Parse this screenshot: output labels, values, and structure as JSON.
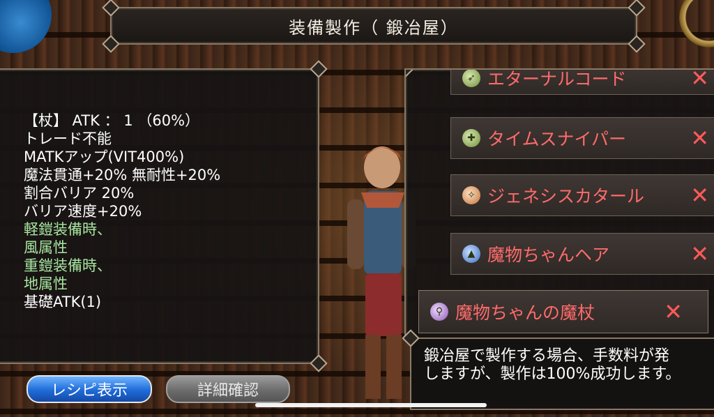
{
  "title": "装備製作（ 鍛冶屋）",
  "item_info": {
    "lines": [
      {
        "text": "【杖】 ATK ： 1 （60%）",
        "color": "white"
      },
      {
        "text": "トレード不能",
        "color": "white"
      },
      {
        "text": "MATKアップ(VIT400%)",
        "color": "white"
      },
      {
        "text": "魔法貫通+20% 無耐性+20%",
        "color": "white"
      },
      {
        "text": "割合バリア 20%",
        "color": "white"
      },
      {
        "text": "バリア速度+20%",
        "color": "white"
      },
      {
        "text": "軽鎧装備時、",
        "color": "green"
      },
      {
        "text": "風属性",
        "color": "green"
      },
      {
        "text": "重鎧装備時、",
        "color": "green"
      },
      {
        "text": "地属性",
        "color": "green"
      },
      {
        "text": "基礎ATK(1)",
        "color": "white"
      }
    ]
  },
  "recipes": [
    {
      "label": "エターナルコード",
      "icon": "bow-icon",
      "close": "✕"
    },
    {
      "label": "タイムスナイパー",
      "icon": "crossbow-icon",
      "close": "✕"
    },
    {
      "label": "ジェネシスカタール",
      "icon": "katar-icon",
      "close": "✕"
    },
    {
      "label": "魔物ちゃんヘア",
      "icon": "hat-icon",
      "close": "✕"
    },
    {
      "label": "魔物ちゃんの魔杖",
      "icon": "staff-icon",
      "close": "✕"
    }
  ],
  "message": {
    "line1": "鍛冶屋で製作する場合、手数料が発",
    "line2": "しますが、製作は100%成功します。"
  },
  "buttons": {
    "recipe": "レシピ表示",
    "detail": "詳細確認"
  },
  "colors": {
    "recipe_text": "#ff6b6b",
    "green_text": "#a8e6a0",
    "blue_button": "#1f6bd8"
  }
}
